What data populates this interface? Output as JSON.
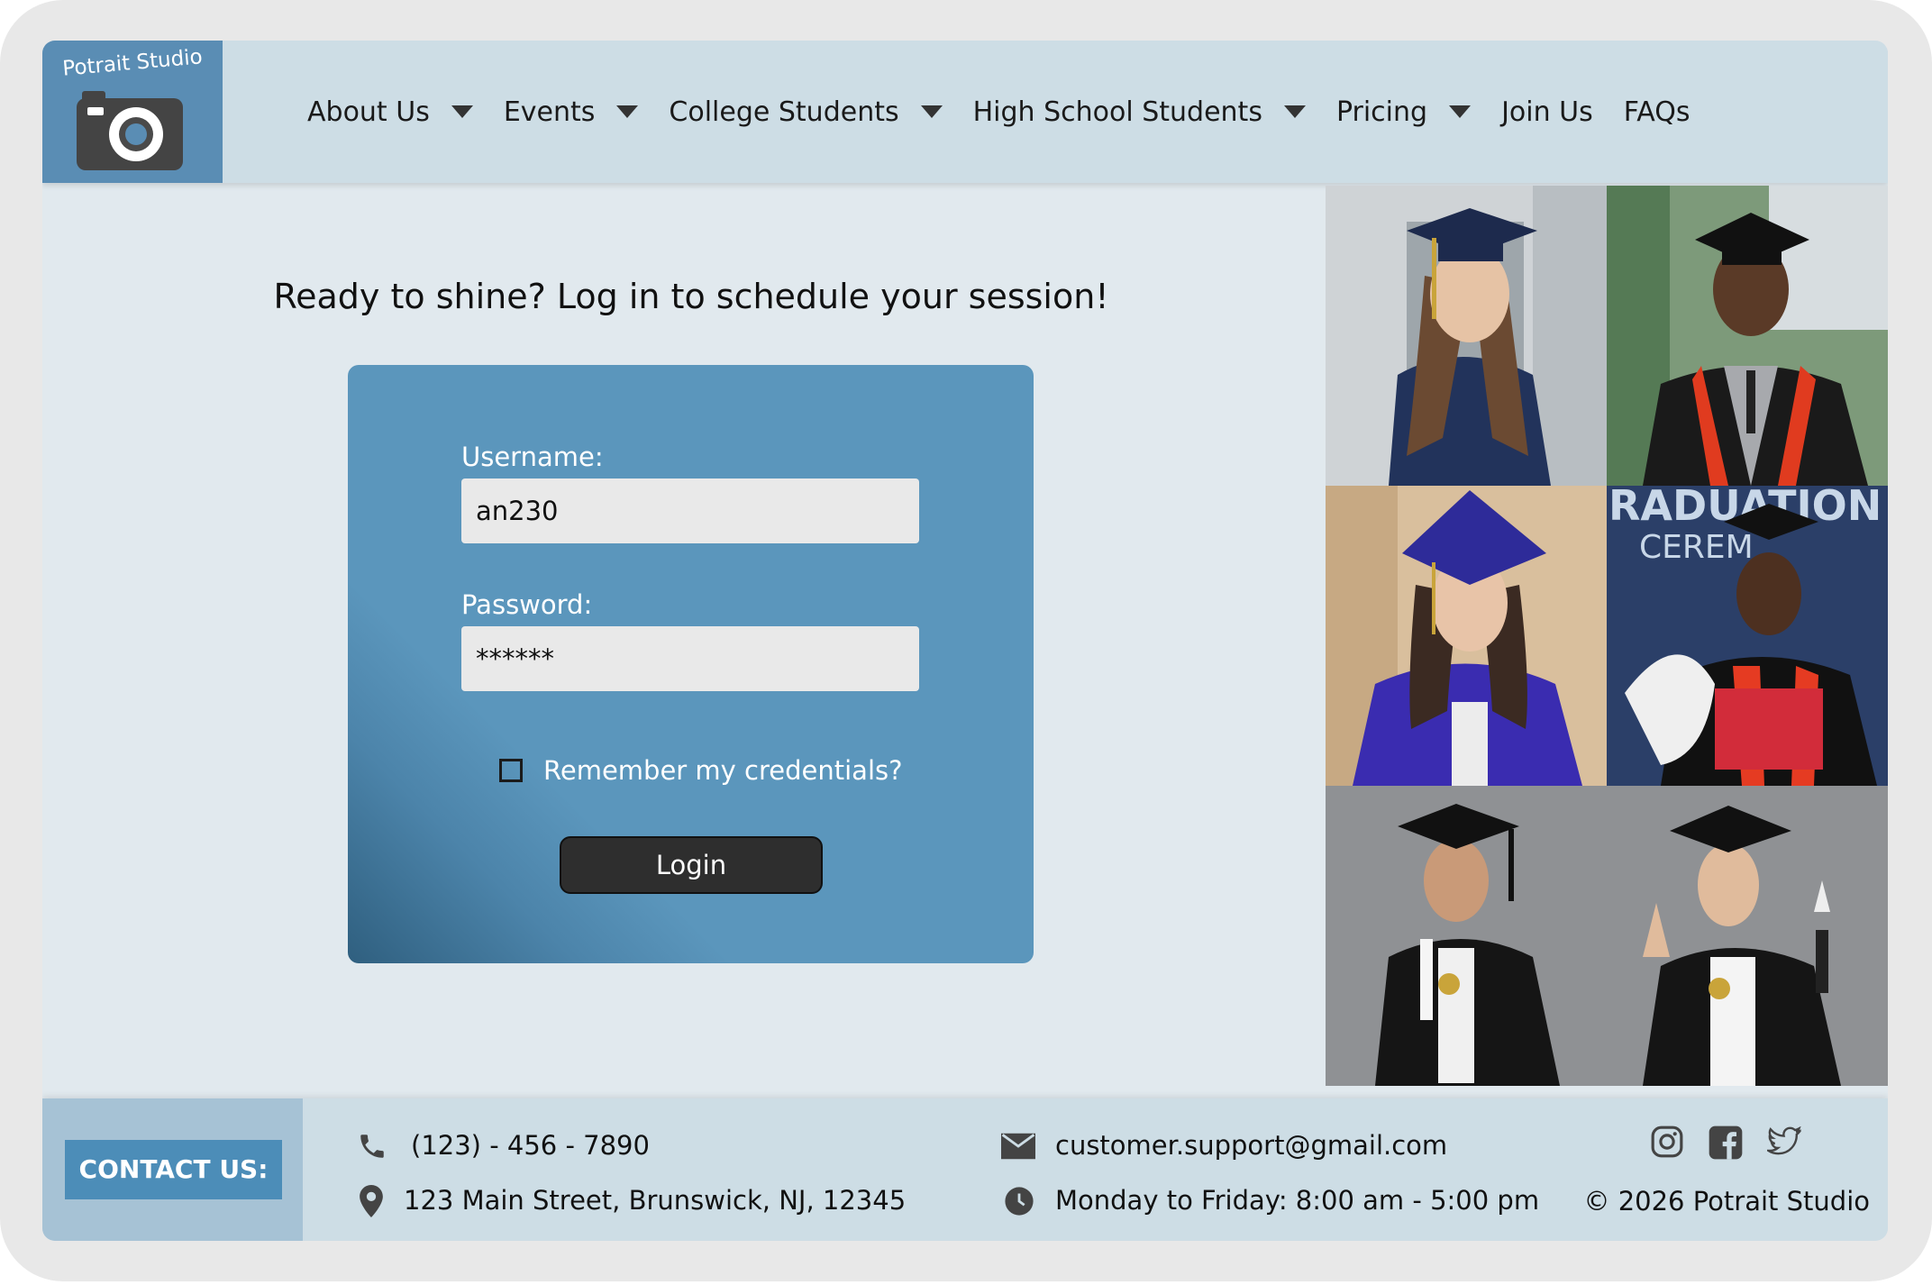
{
  "brand": {
    "name": "Potrait Studio"
  },
  "nav": {
    "items": [
      {
        "label": "About Us",
        "dropdown": true
      },
      {
        "label": "Events",
        "dropdown": true
      },
      {
        "label": "College Students",
        "dropdown": true
      },
      {
        "label": "High School Students",
        "dropdown": true
      },
      {
        "label": "Pricing",
        "dropdown": true
      },
      {
        "label": "Join Us",
        "dropdown": false
      },
      {
        "label": "FAQs",
        "dropdown": false
      }
    ]
  },
  "main": {
    "headline": "Ready to shine? Log in to schedule your session!",
    "login": {
      "username_label": "Username:",
      "username_value": "an230",
      "password_label": "Password:",
      "password_value": "******",
      "remember_label": "Remember my credentials?",
      "remember_checked": false,
      "submit_label": "Login"
    }
  },
  "gallery": {
    "photos": [
      {
        "icon": "graduate-photo"
      },
      {
        "icon": "graduate-photo"
      },
      {
        "icon": "graduate-photo"
      },
      {
        "icon": "graduate-photo",
        "banner_text": "RADUATION",
        "banner_sub": "CEREM"
      },
      {
        "icon": "graduate-photo"
      },
      {
        "icon": "graduate-photo"
      }
    ]
  },
  "footer": {
    "contact_label": "CONTACT US:",
    "phone": "(123) - 456 - 7890",
    "address": "123 Main Street, Brunswick, NJ, 12345",
    "email": "customer.support@gmail.com",
    "hours": "Monday to Friday: 8:00 am - 5:00 pm",
    "copyright": "© 2026 Potrait Studio",
    "social": [
      "instagram-icon",
      "facebook-icon",
      "twitter-icon"
    ]
  },
  "colors": {
    "nav_bg": "#cddde5",
    "logo_bg": "#5a8db4",
    "page_bg": "#e1e9ee",
    "card_bg": "#5b96bc",
    "button_bg": "#2e2e2e",
    "contact_btn": "#4c8db8"
  }
}
